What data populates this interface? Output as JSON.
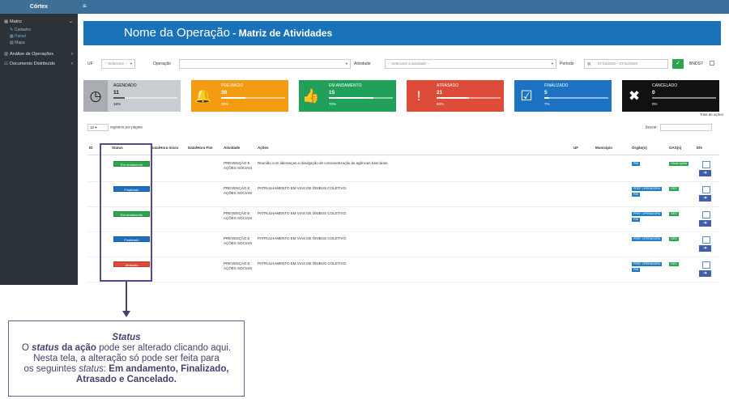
{
  "sidebar": {
    "brand": "Córtex",
    "items": [
      {
        "label": "Matriz",
        "icon": "table-icon"
      },
      {
        "label": "Cadastro",
        "sub": true
      },
      {
        "label": "Painel",
        "sub": true
      },
      {
        "label": "Mapa",
        "sub": true
      },
      {
        "label": "Análise de Operações",
        "icon": "chart-icon"
      },
      {
        "label": "Documento Distribuído",
        "icon": "users-icon"
      }
    ]
  },
  "banner": {
    "title_light": "Nome da Operação",
    "title_bold": " - Matriz de Atividades"
  },
  "filters": {
    "uf_label": "UF",
    "uf_placeholder": "-- Selecione --",
    "operacao_label": "Operação",
    "atividade_label": "Atividade",
    "atividade_placeholder": "-- Selecione a atividade --",
    "periodo_label": "Período",
    "periodo_value": "07/12/2020 - 07/12/2020",
    "extra_label": "BNDS?"
  },
  "cards": [
    {
      "label": "AGENDADO",
      "value": "11",
      "pct": "18%",
      "fill": 0.18,
      "color": "#c9ccd1",
      "iconbg": "#a9adb3",
      "icon": "clock-icon",
      "glyph": "◷",
      "dark": true
    },
    {
      "label": "PRÉ-INÍCIO",
      "value": "38",
      "pct": "38%",
      "fill": 0.38,
      "color": "#f39c12",
      "iconbg": "#f39c12",
      "icon": "bell-icon",
      "glyph": "🔔"
    },
    {
      "label": "EM ANDAMENTO",
      "value": "15",
      "pct": "70%",
      "fill": 0.7,
      "color": "#21a05a",
      "iconbg": "#21a05a",
      "icon": "thumbs-up-icon",
      "glyph": "👍"
    },
    {
      "label": "ATRASADO",
      "value": "21",
      "pct": "50%",
      "fill": 0.5,
      "color": "#dd4b39",
      "iconbg": "#dd4b39",
      "icon": "exclamation-icon",
      "glyph": "!"
    },
    {
      "label": "FINALIZADO",
      "value": "5",
      "pct": "7%",
      "fill": 0.07,
      "color": "#1d72c1",
      "iconbg": "#1d72c1",
      "icon": "checkbox-icon",
      "glyph": "☑"
    },
    {
      "label": "CANCELADO",
      "value": "0",
      "pct": "0%",
      "fill": 0.0,
      "color": "#111111",
      "iconbg": "#111111",
      "icon": "close-icon",
      "glyph": "✖"
    }
  ],
  "totals_label": "Total de ações",
  "table": {
    "length_value": "10",
    "length_text": "registros por página",
    "search_label": "Buscar:",
    "headers": [
      "ID",
      "Status",
      "Data/Hora Início",
      "Data/Hora Fim",
      "Atividade",
      "Ações",
      "UF",
      "Município",
      "Órgão(s)",
      "GAS(s)",
      "Efe"
    ],
    "rows": [
      {
        "status": "Em andamento",
        "status_color": "#2ea44f",
        "atividade": "PREVENÇÃO E AÇÕES SOCIAIS",
        "acao": "Reunião com lideranças e divulgação de conscientização às agências bancárias",
        "orgaos": [
          "PMI"
        ],
        "gas": "Várias ações",
        "gas_color": "#2ea44f"
      },
      {
        "status": "Finalizado",
        "status_color": "#1f6fc0",
        "atividade": "PREVENÇÃO E AÇÕES SOCIAIS",
        "acao": "PATRULHAMENTO EM VIAS DE ÔNIBUS COLETIVO.",
        "orgaos": [
          "PREF. OPERADORA",
          "PMI"
        ],
        "gas": "GEO",
        "gas_color": "#2ea44f"
      },
      {
        "status": "Em andamento",
        "status_color": "#2ea44f",
        "atividade": "PREVENÇÃO E AÇÕES SOCIAIS",
        "acao": "PATRULHAMENTO EM VIAS DE ÔNIBUS COLETIVO.",
        "orgaos": [
          "PREF. OPERADORA",
          "PMI"
        ],
        "gas": "GEO",
        "gas_color": "#2ea44f"
      },
      {
        "status": "Finalizado",
        "status_color": "#1f6fc0",
        "atividade": "PREVENÇÃO E AÇÕES SOCIAIS",
        "acao": "PATRULHAMENTO EM VIAS DE ÔNIBUS COLETIVO.",
        "orgaos": [
          "PREF. OPERADORA"
        ],
        "gas": "GEO",
        "gas_color": "#2ea44f"
      },
      {
        "status": "Atrasado",
        "status_color": "#dd4b39",
        "atividade": "PREVENÇÃO E AÇÕES SOCIAIS",
        "acao": "PATRULHAMENTO EM VIAS DE ÔNIBUS COLETIVO.",
        "orgaos": [
          "PREF. OPERADORA",
          "PMI"
        ],
        "gas": "GEO",
        "gas_color": "#2ea44f"
      }
    ]
  },
  "note": {
    "title": "Status",
    "l1a": "O ",
    "l1b": "status",
    "l1c": " da ação",
    "l1d": " pode ser alterado clicando aqui.",
    "l2": "Nesta tela, a alteração só pode ser feita para",
    "l3a": "os seguintes ",
    "l3b": "status",
    "l3c": ": ",
    "l3d": "Em andamento, Finalizado,",
    "l4": "Atrasado e Cancelado."
  }
}
